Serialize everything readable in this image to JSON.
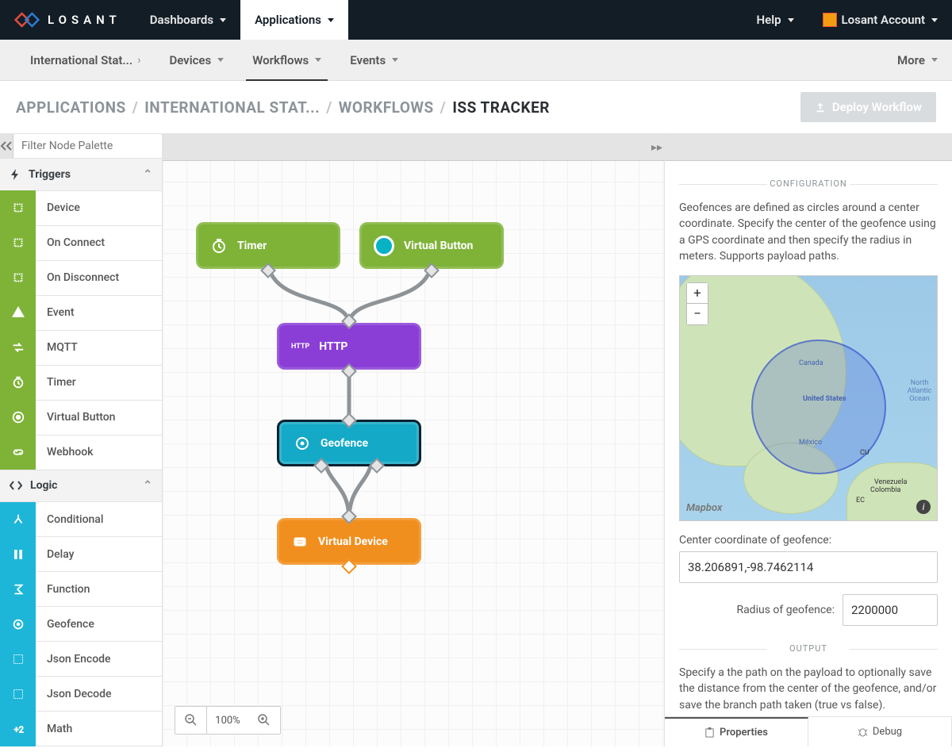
{
  "brand": "LOSANT",
  "topnav": {
    "dashboards": "Dashboards",
    "applications": "Applications",
    "help": "Help",
    "account": "Losant Account"
  },
  "subnav": {
    "app": "International Stat...",
    "devices": "Devices",
    "workflows": "Workflows",
    "events": "Events",
    "more": "More"
  },
  "breadcrumb": {
    "applications": "APPLICATIONS",
    "app": "INTERNATIONAL STAT...",
    "workflows": "WORKFLOWS",
    "current": "ISS TRACKER"
  },
  "deploy": "Deploy Workflow",
  "palette": {
    "filter_placeholder": "Filter Node Palette",
    "sections": {
      "triggers": {
        "title": "Triggers",
        "items": [
          "Device",
          "On Connect",
          "On Disconnect",
          "Event",
          "MQTT",
          "Timer",
          "Virtual Button",
          "Webhook"
        ]
      },
      "logic": {
        "title": "Logic",
        "items": [
          "Conditional",
          "Delay",
          "Function",
          "Geofence",
          "Json Encode",
          "Json Decode",
          "Math"
        ]
      }
    }
  },
  "canvas": {
    "nodes": {
      "timer": "Timer",
      "vbutton": "Virtual Button",
      "http": "HTTP",
      "http_prefix": "HTTP",
      "geofence": "Geofence",
      "vdevice": "Virtual Device"
    },
    "zoom": "100%"
  },
  "config": {
    "section_title": "CONFIGURATION",
    "desc": "Geofences are defined as circles around a center coordinate. Specify the center of the geofence using a GPS coordinate and then specify the radius in meters. Supports payload paths.",
    "map": {
      "zoom_in": "+",
      "zoom_out": "−",
      "attr": "Mapbox",
      "labels": {
        "canada": "Canada",
        "us": "United States",
        "mexico": "México",
        "cu": "CU",
        "venezuela": "Venezuela",
        "colombia": "Colombia",
        "ec": "EC",
        "na": "North Atlantic Ocean"
      }
    },
    "center_label": "Center coordinate of geofence:",
    "center_value": "38.206891,-98.7462114",
    "radius_label": "Radius of geofence:",
    "radius_value": "2200000",
    "output_title": "OUTPUT",
    "output_desc": "Specify a the path on the payload to optionally save the distance from the center of the geofence, and/or save the branch path taken (true vs false)."
  },
  "tabs": {
    "properties": "Properties",
    "debug": "Debug"
  }
}
